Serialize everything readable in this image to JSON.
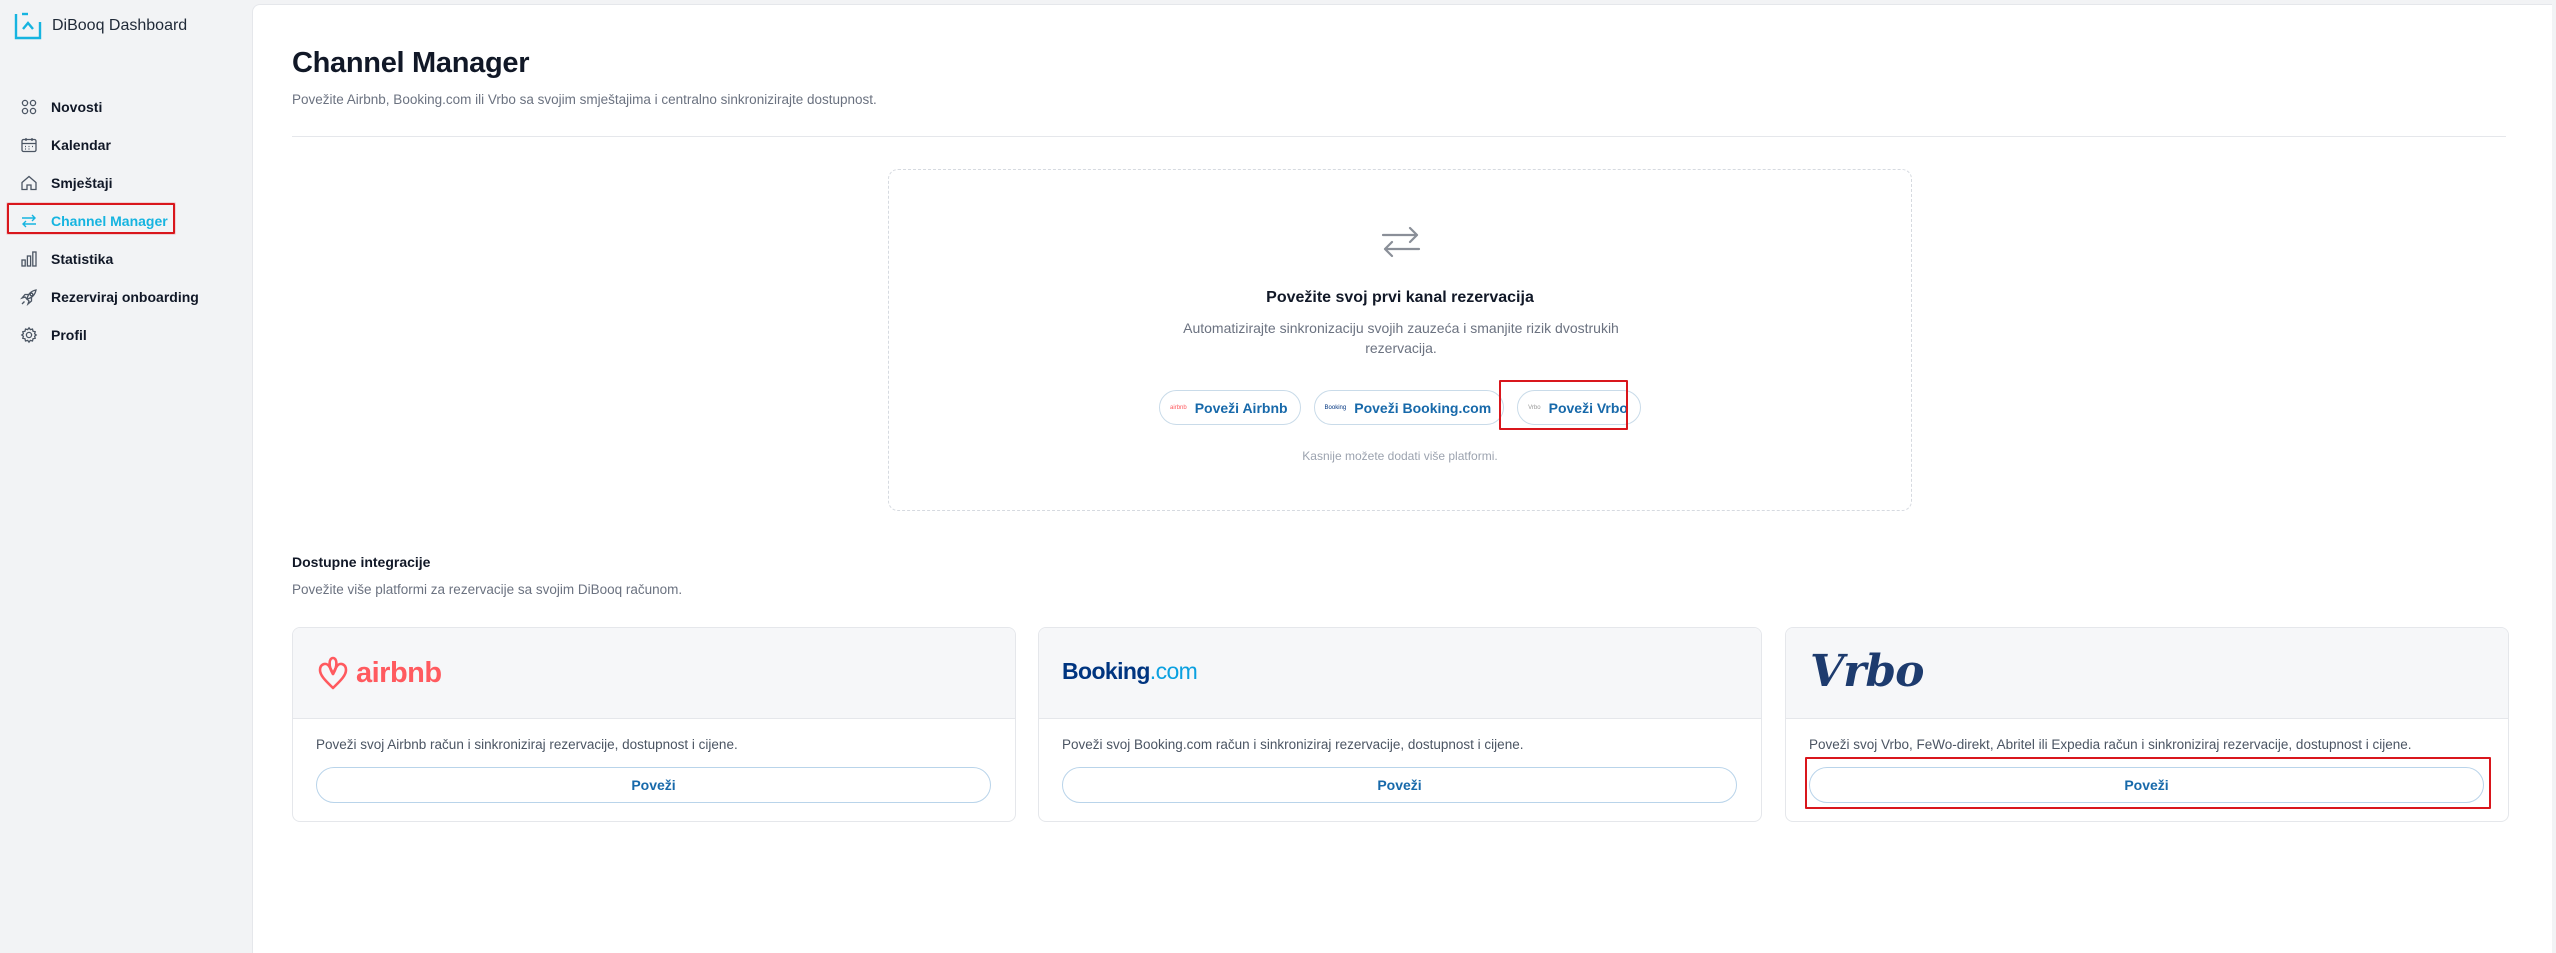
{
  "brand": {
    "name": "DiBooq Dashboard",
    "accent": "#16b4e0"
  },
  "sidebar": {
    "items": [
      {
        "label": "Novosti",
        "icon": "grid-icon"
      },
      {
        "label": "Kalendar",
        "icon": "calendar-icon"
      },
      {
        "label": "Smještaji",
        "icon": "home-icon"
      },
      {
        "label": "Channel Manager",
        "icon": "arrows-exchange-icon",
        "active": true
      },
      {
        "label": "Statistika",
        "icon": "bar-chart-icon"
      },
      {
        "label": "Rezerviraj onboarding",
        "icon": "rocket-icon"
      },
      {
        "label": "Profil",
        "icon": "gear-icon"
      }
    ]
  },
  "page": {
    "title": "Channel Manager",
    "subtitle": "Povežite Airbnb, Booking.com ili Vrbo sa svojim smještajima i centralno sinkronizirajte dostupnost."
  },
  "empty_state": {
    "icon": "arrows-exchange-icon",
    "title": "Povežite svoj prvi kanal rezervacija",
    "description": "Automatizirajte sinkronizaciju svojih zauzeća i smanjite rizik dvostrukih rezervacija.",
    "buttons": [
      {
        "label": "Poveži Airbnb",
        "mini": "airbnb"
      },
      {
        "label": "Poveži Booking.com",
        "mini": "Booking"
      },
      {
        "label": "Poveži Vrbo",
        "mini": "Vrbo"
      }
    ],
    "footnote": "Kasnije možete dodati više platformi."
  },
  "integrations": {
    "title": "Dostupne integracije",
    "subtitle": "Povežite više platformi za rezervacije sa svojim DiBooq računom.",
    "cards": [
      {
        "logo": "airbnb",
        "description": "Poveži svoj Airbnb račun i sinkroniziraj rezervacije, dostupnost i cijene.",
        "button": "Poveži"
      },
      {
        "logo_main": "Booking",
        "logo_dot": ".com",
        "description": "Poveži svoj Booking.com račun i sinkroniziraj rezervacije, dostupnost i cijene.",
        "button": "Poveži"
      },
      {
        "logo": "Vrbo",
        "description": "Poveži svoj Vrbo, FeWo-direkt, Abritel ili Expedia račun i sinkroniziraj rezervacije, dostupnost i cijene.",
        "button": "Poveži"
      }
    ]
  }
}
